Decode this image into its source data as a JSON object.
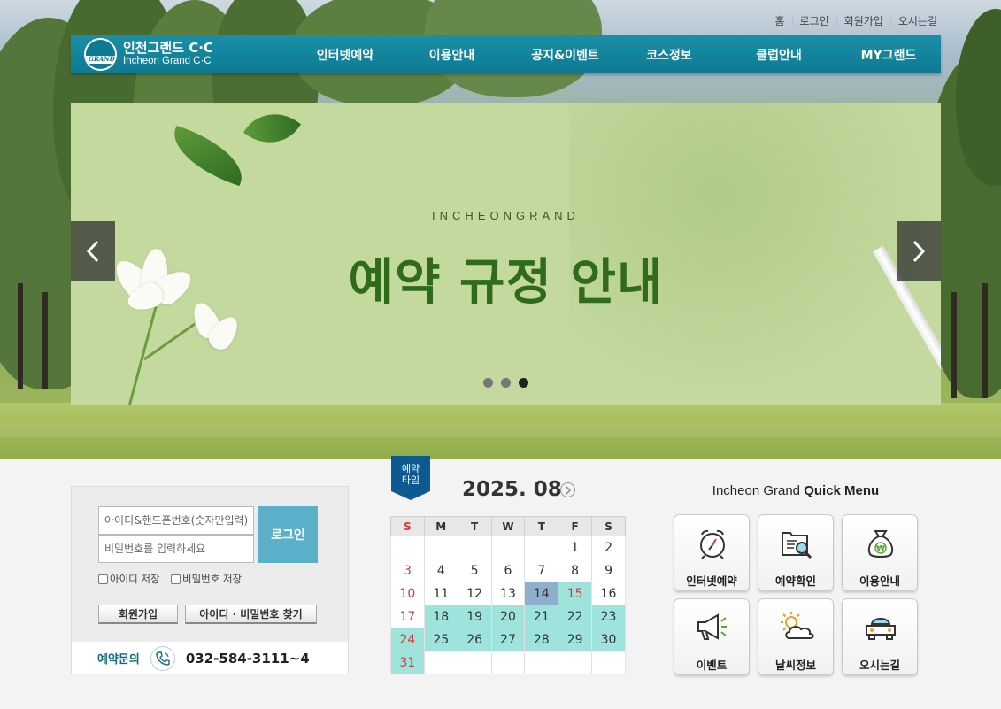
{
  "util_links": [
    "홈",
    "로그인",
    "회원가입",
    "오시는길"
  ],
  "logo": {
    "korean": "인천그랜드 C·C",
    "english": "Incheon Grand C·C",
    "mark_text": "GRAND"
  },
  "nav": [
    "인터넷예약",
    "이용안내",
    "공지&이벤트",
    "코스정보",
    "클럽안내",
    "MY그랜드"
  ],
  "slider": {
    "subtitle": "INCHEONGRAND",
    "title": "예약 규정 안내",
    "slide_count": 3,
    "active_slide": 3
  },
  "login": {
    "id_placeholder": "아이디&핸드폰번호(숫자만입력)",
    "pw_placeholder": "비밀번호를 입력하세요",
    "login_button": "로그인",
    "save_id": "아이디 저장",
    "save_pw": "비밀번호 저장",
    "join_button": "회원가입",
    "find_button": "아이디 · 비밀번호 찾기",
    "contact_label": "예약문의",
    "contact_number": "032-584-3111~4"
  },
  "calendar": {
    "ribbon_line1": "예약",
    "ribbon_line2": "타임",
    "month": "2025. 08",
    "weekdays": [
      "S",
      "M",
      "T",
      "W",
      "T",
      "F",
      "S"
    ],
    "weeks": [
      [
        "",
        "",
        "",
        "",
        "",
        "1",
        "2"
      ],
      [
        "3",
        "4",
        "5",
        "6",
        "7",
        "8",
        "9"
      ],
      [
        "10",
        "11",
        "12",
        "13",
        "14",
        "15",
        "16"
      ],
      [
        "17",
        "18",
        "19",
        "20",
        "21",
        "22",
        "23"
      ],
      [
        "24",
        "25",
        "26",
        "27",
        "28",
        "29",
        "30"
      ],
      [
        "31",
        "",
        "",
        "",
        "",
        "",
        ""
      ]
    ],
    "today": "14",
    "available": [
      "15",
      "18",
      "19",
      "20",
      "21",
      "22",
      "23",
      "24",
      "25",
      "26",
      "27",
      "28",
      "29",
      "30",
      "31"
    ],
    "colors": {
      "available": "#9fe4dc",
      "today": "#8fb0cc",
      "sunday": "#d23c3c"
    }
  },
  "quick_menu": {
    "title_prefix": "Incheon Grand",
    "title_bold": "Quick Menu",
    "items": [
      {
        "label": "인터넷예약",
        "icon": "alarm-clock-icon"
      },
      {
        "label": "예약확인",
        "icon": "document-search-icon"
      },
      {
        "label": "이용안내",
        "icon": "money-bag-icon"
      },
      {
        "label": "이벤트",
        "icon": "megaphone-icon"
      },
      {
        "label": "날씨정보",
        "icon": "sun-cloud-icon"
      },
      {
        "label": "오시는길",
        "icon": "car-icon"
      }
    ]
  },
  "colors": {
    "nav": "#0e7a93",
    "login_button": "#5bafc9",
    "ribbon": "#0d5a93",
    "slider_bg": "#c3d99e",
    "slider_title": "#2f6b1a"
  }
}
